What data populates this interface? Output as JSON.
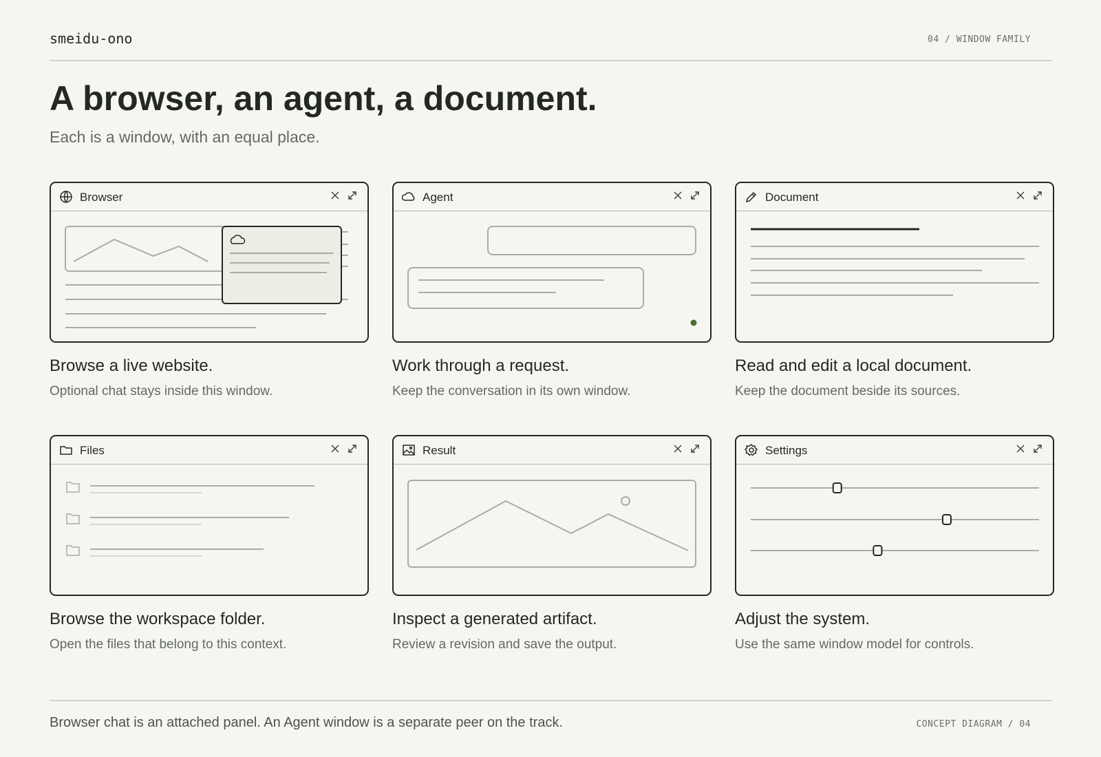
{
  "header": {
    "wordmark": "smeidu-ono",
    "page_id": "04 / WINDOW FAMILY",
    "title": "A browser, an agent, a document.",
    "subtitle": "Each is a window, with an equal place."
  },
  "cards": [
    {
      "window_title": "Browser",
      "icon": "globe-icon",
      "title": "Browse a live website.",
      "description": "Optional chat stays inside this window."
    },
    {
      "window_title": "Agent",
      "icon": "cloud-icon",
      "title": "Work through a request.",
      "description": "Keep the conversation in its own window."
    },
    {
      "window_title": "Document",
      "icon": "pencil-icon",
      "title": "Read and edit a local document.",
      "description": "Keep the document beside its sources."
    },
    {
      "window_title": "Files",
      "icon": "folder-icon",
      "title": "Browse the workspace folder.",
      "description": "Open the files that belong to this context."
    },
    {
      "window_title": "Result",
      "icon": "image-icon",
      "title": "Inspect a generated artifact.",
      "description": "Review a revision and save the output."
    },
    {
      "window_title": "Settings",
      "icon": "gear-icon",
      "title": "Adjust the system.",
      "description": "Use the same window model for controls."
    }
  ],
  "settings_sliders": [
    0.3,
    0.68,
    0.44
  ],
  "footer": {
    "caption": "Browser chat is an attached panel. An Agent window is a separate peer on the track.",
    "page_id": "CONCEPT DIAGRAM / 04"
  },
  "colors": {
    "background": "#f6f6f1",
    "ink": "#232823",
    "muted": "#626a60",
    "wireframe": "#a9aca5",
    "panel": "#eceee6",
    "accent_green": "#4d6b34"
  }
}
